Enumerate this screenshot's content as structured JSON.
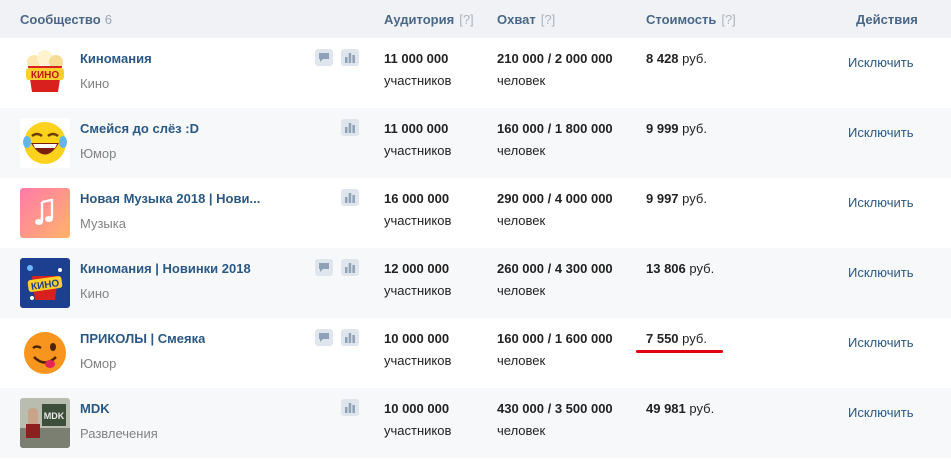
{
  "header": {
    "community_label": "Сообщество",
    "community_count": "6",
    "audience_label": "Аудитория",
    "reach_label": "Охват",
    "cost_label": "Стоимость",
    "actions_label": "Действия",
    "help_mark": "[?]"
  },
  "rows": [
    {
      "name": "Киномания",
      "category": "Кино",
      "audience": "11 000 000",
      "audience_unit": "участников",
      "reach": "210 000 / 2 000 000",
      "reach_unit": "человек",
      "price": "8 428",
      "currency": "руб.",
      "action": "Исключить",
      "avatar_text": "КИНО",
      "has_comment_icon": true
    },
    {
      "name": "Смейся до слёз :D",
      "category": "Юмор",
      "audience": "11 000 000",
      "audience_unit": "участников",
      "reach": "160 000 / 1 800 000",
      "reach_unit": "человек",
      "price": "9 999",
      "currency": "руб.",
      "action": "Исключить",
      "has_comment_icon": false
    },
    {
      "name": "Новая Музыка 2018 | Нови...",
      "category": "Музыка",
      "audience": "16 000 000",
      "audience_unit": "участников",
      "reach": "290 000 / 4 000 000",
      "reach_unit": "человек",
      "price": "9 997",
      "currency": "руб.",
      "action": "Исключить",
      "has_comment_icon": false
    },
    {
      "name": "Киномания | Новинки 2018",
      "category": "Кино",
      "audience": "12 000 000",
      "audience_unit": "участников",
      "reach": "260 000 / 4 300 000",
      "reach_unit": "человек",
      "price": "13 806",
      "currency": "руб.",
      "action": "Исключить",
      "avatar_text": "КИНО",
      "has_comment_icon": true
    },
    {
      "name": "ПРИКОЛЫ | Смеяка",
      "category": "Юмор",
      "audience": "10 000 000",
      "audience_unit": "участников",
      "reach": "160 000 / 1 600 000",
      "reach_unit": "человек",
      "price": "7 550",
      "currency": "руб.",
      "action": "Исключить",
      "has_comment_icon": true
    },
    {
      "name": "MDK",
      "category": "Развлечения",
      "audience": "10 000 000",
      "audience_unit": "участников",
      "reach": "430 000 / 3 500 000",
      "reach_unit": "человек",
      "price": "49 981",
      "currency": "руб.",
      "action": "Исключить",
      "avatar_text": "MDK",
      "has_comment_icon": false
    }
  ],
  "colors": {
    "link": "#2a5885",
    "header_bg": "#f0f2f5",
    "highlight": "#e0000f"
  }
}
